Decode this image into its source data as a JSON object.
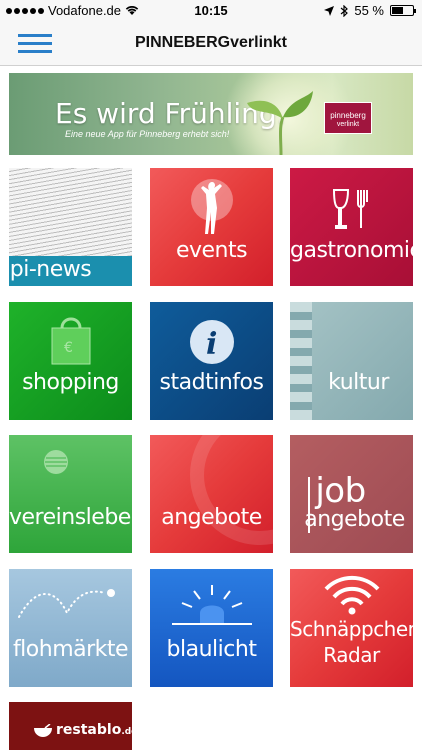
{
  "status_bar": {
    "carrier": "Vodafone.de",
    "time": "10:15",
    "battery": "55 %",
    "battery_fill": 0.55
  },
  "navbar": {
    "title": "PINNEBERGverlinkt",
    "menu_icon": "hamburger-icon"
  },
  "banner": {
    "headline": "Es wird Frühling.",
    "subline": "Eine neue App für Pinneberg erhebt sich!",
    "badge_line1": "pinneberg",
    "badge_line2": "verlinkt"
  },
  "tiles": [
    {
      "label": "pi-news",
      "icon": "newspaper-icon"
    },
    {
      "label": "events",
      "icon": "dancer-icon"
    },
    {
      "label": "gastronomie",
      "icon": "glass-fork-icon"
    },
    {
      "label": "shopping",
      "icon": "shopping-bag-icon"
    },
    {
      "label": "stadtinfos",
      "icon": "info-icon"
    },
    {
      "label": "kultur",
      "icon": "film-strip-icon"
    },
    {
      "label": "vereinsleben",
      "icon": "ball-icon"
    },
    {
      "label": "angebote",
      "icon": ""
    },
    {
      "label_line1": "job",
      "label_line2": "angebote",
      "icon": ""
    },
    {
      "label": "flohmärkte",
      "icon": "bouncing-dots-icon"
    },
    {
      "label": "blaulicht",
      "icon": "siren-icon"
    },
    {
      "label_line1": "Schnäppchen-",
      "label_line2": "Radar",
      "icon": "wifi-signal-icon"
    },
    {
      "label": "restablo",
      "label_suffix": ".de",
      "icon": "bowl-icon"
    }
  ],
  "colors": {
    "accent": "#2a7fc9",
    "red": "#e53b3b",
    "green": "#1fb22a",
    "navy": "#0a3e73"
  }
}
